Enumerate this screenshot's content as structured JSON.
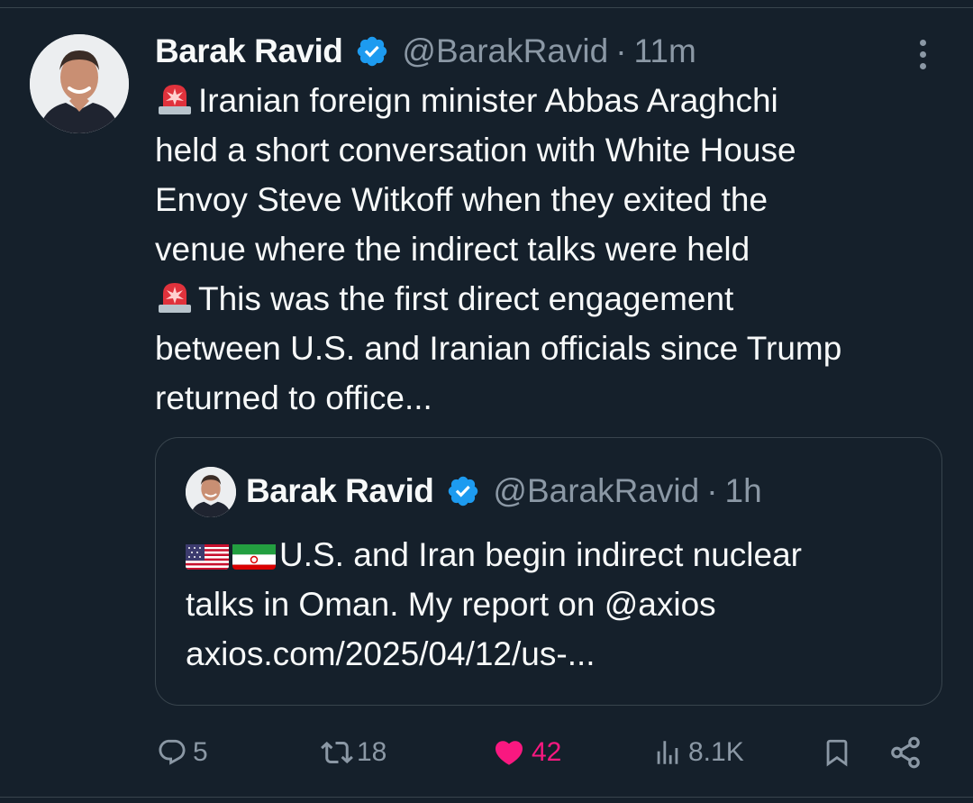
{
  "tweet": {
    "author_name": "Barak Ravid",
    "handle": "@BarakRavid",
    "separator": "·",
    "time": "11m",
    "lines": [
      "Iranian foreign minister Abbas Araghchi",
      "held a short conversation with White House",
      "Envoy Steve Witkoff when they exited the",
      "venue where the indirect talks were held",
      "This was the first direct engagement",
      "between U.S. and Iranian officials since Trump",
      "returned to office..."
    ]
  },
  "quote": {
    "author_name": "Barak Ravid",
    "handle": "@BarakRavid",
    "separator": "·",
    "time": "1h",
    "lines": [
      "U.S. and Iran begin indirect nuclear",
      "talks in Oman. My report on @axios",
      "axios.com/2025/04/12/us-..."
    ]
  },
  "actions": {
    "replies": "5",
    "reposts": "18",
    "likes": "42",
    "views": "8.1K"
  },
  "colors": {
    "background": "#15202b",
    "accent_blue": "#1d9bf0",
    "like_pink": "#f91880",
    "secondary_text": "#8b98a5"
  },
  "icons": [
    "siren-icon",
    "us-flag-icon",
    "iran-flag-icon",
    "verified-badge-icon",
    "more-icon",
    "reply-icon",
    "repost-icon",
    "heart-icon",
    "views-icon",
    "bookmark-icon",
    "share-icon"
  ]
}
